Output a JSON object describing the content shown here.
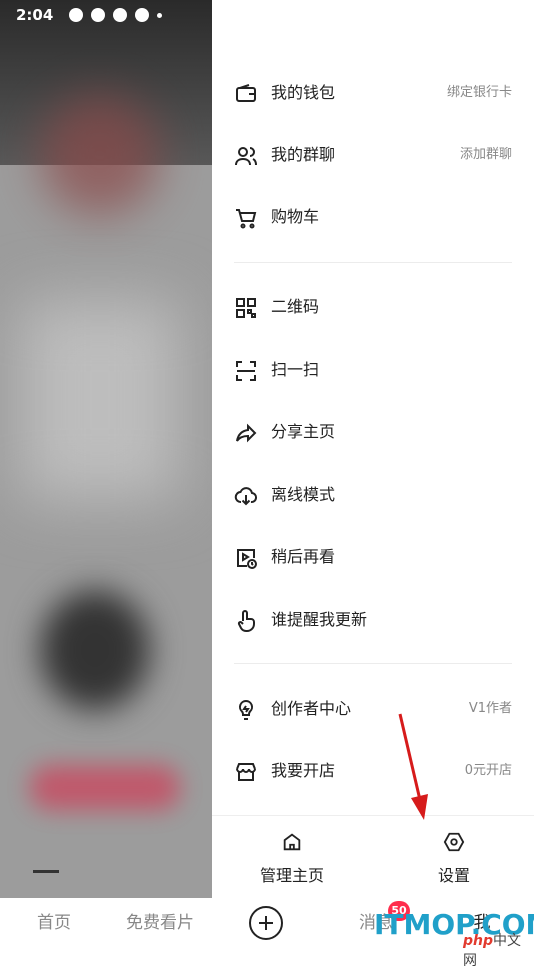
{
  "status_bar": {
    "time": "2:04"
  },
  "menu": {
    "items": [
      {
        "icon": "wallet-icon",
        "label": "我的钱包",
        "right": "绑定银行卡"
      },
      {
        "icon": "group-chat-icon",
        "label": "我的群聊",
        "right": "添加群聊"
      },
      {
        "icon": "cart-icon",
        "label": "购物车",
        "right": ""
      },
      {
        "icon": "qrcode-icon",
        "label": "二维码",
        "right": ""
      },
      {
        "icon": "scan-icon",
        "label": "扫一扫",
        "right": ""
      },
      {
        "icon": "share-icon",
        "label": "分享主页",
        "right": ""
      },
      {
        "icon": "offline-download-icon",
        "label": "离线模式",
        "right": ""
      },
      {
        "icon": "watch-later-icon",
        "label": "稍后再看",
        "right": ""
      },
      {
        "icon": "remind-update-icon",
        "label": "谁提醒我更新",
        "right": ""
      },
      {
        "icon": "lightbulb-icon",
        "label": "创作者中心",
        "right": "V1作者"
      },
      {
        "icon": "shop-icon",
        "label": "我要开店",
        "right": "0元开店"
      }
    ]
  },
  "drawer_bottom": {
    "manage_home": "管理主页",
    "settings": "设置"
  },
  "tab_bar": {
    "home": "首页",
    "free_watch": "免费看片",
    "messages": "消息",
    "messages_badge": "50",
    "me": "我"
  },
  "watermark": {
    "main": "ITMOP.COM",
    "php": "php",
    "site": "中文网"
  },
  "colors": {
    "badge": "#ff2e4d",
    "arrow": "#d61b1b",
    "watermark": "#20a0c9"
  }
}
